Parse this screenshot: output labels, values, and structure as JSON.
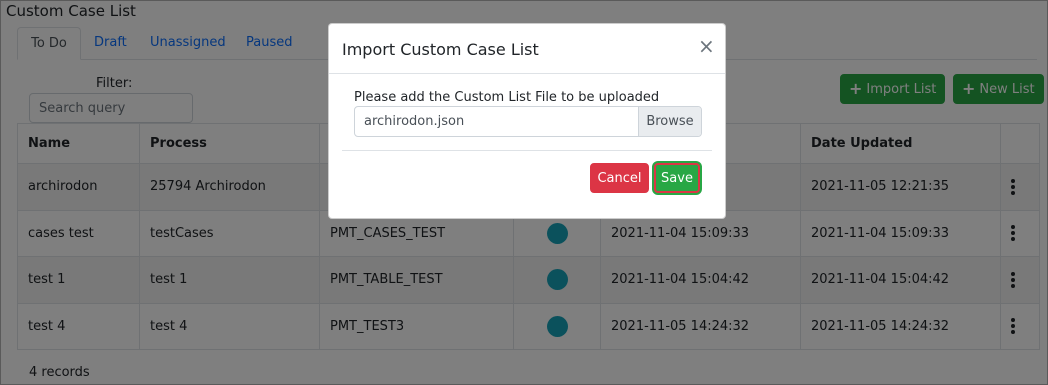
{
  "page": {
    "title": "Custom Case List"
  },
  "tabs": [
    {
      "label": "To Do",
      "active": true
    },
    {
      "label": "Draft",
      "active": false
    },
    {
      "label": "Unassigned",
      "active": false
    },
    {
      "label": "Paused",
      "active": false
    }
  ],
  "filter": {
    "label": "Filter:",
    "placeholder": "Search query",
    "value": ""
  },
  "toolbar": {
    "import_label": "Import List",
    "new_label": "New List",
    "button_color": "#28a745"
  },
  "table": {
    "columns": [
      "Name",
      "Process",
      "",
      "",
      "",
      "Date Updated",
      ""
    ],
    "rows": [
      {
        "name": "archirodon",
        "process": "25794 Archirodon",
        "code": "",
        "date_created": "",
        "date_updated": "2021-11-05 12:21:35"
      },
      {
        "name": "cases test",
        "process": "testCases",
        "code": "PMT_CASES_TEST",
        "date_created": "2021-11-04 15:09:33",
        "date_updated": "2021-11-04 15:09:33"
      },
      {
        "name": "test 1",
        "process": "test 1",
        "code": "PMT_TABLE_TEST",
        "date_created": "2021-11-04 15:04:42",
        "date_updated": "2021-11-04 15:04:42"
      },
      {
        "name": "test 4",
        "process": "test 4",
        "code": "PMT_TEST3",
        "date_created": "2021-11-05 14:24:32",
        "date_updated": "2021-11-05 14:24:32"
      }
    ],
    "footer": "4 records"
  },
  "modal": {
    "title": "Import Custom Case List",
    "close": "×",
    "file_label": "Please add the Custom List File to be uploaded",
    "file_name": "archirodon.json",
    "browse_label": "Browse",
    "cancel_label": "Cancel",
    "save_label": "Save"
  },
  "colors": {
    "avatar": "#17a2b8",
    "cancel": "#dc3545",
    "save": "#28a745"
  }
}
